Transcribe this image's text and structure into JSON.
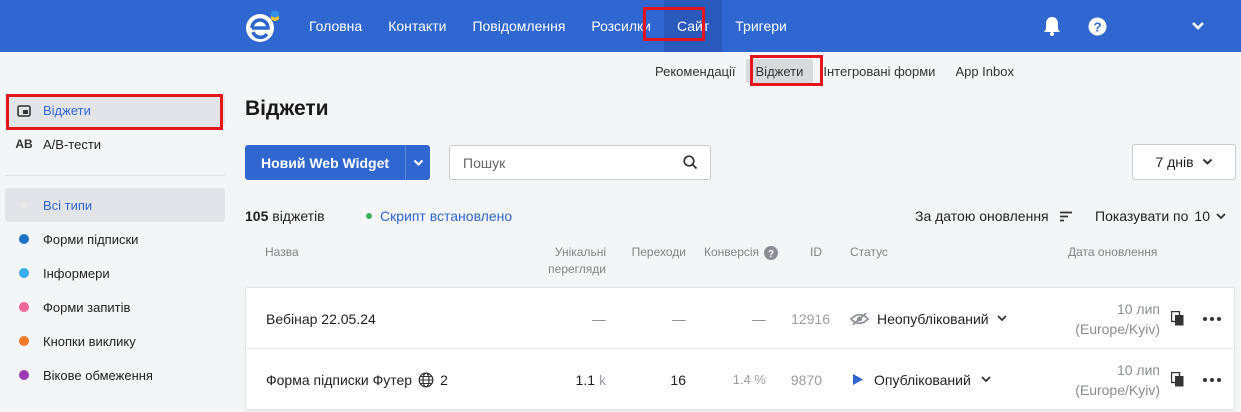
{
  "topnav": {
    "items": [
      {
        "label": "Головна"
      },
      {
        "label": "Контакти"
      },
      {
        "label": "Повідомлення"
      },
      {
        "label": "Розсилки"
      },
      {
        "label": "Сайт",
        "active": true
      },
      {
        "label": "Тригери"
      }
    ],
    "icons": [
      "bell-icon",
      "help-icon",
      "chevron-down-icon"
    ]
  },
  "subnav": {
    "items": [
      {
        "label": "Рекомендації"
      },
      {
        "label": "Віджети",
        "active": true
      },
      {
        "label": "Інтегровані форми"
      },
      {
        "label": "App Inbox"
      }
    ]
  },
  "sidebar": {
    "sections": [
      {
        "label": "Віджети",
        "icon": "widget-icon",
        "active": true
      },
      {
        "label": "A/B-тести",
        "icon_text": "AB"
      }
    ],
    "types": [
      {
        "label": "Всі типи",
        "color": "#e6e6e6",
        "active": true
      },
      {
        "label": "Форми підписки",
        "color": "#1a73c8"
      },
      {
        "label": "Інформери",
        "color": "#3aabee"
      },
      {
        "label": "Форми запитів",
        "color": "#ee6597"
      },
      {
        "label": "Кнопки виклику",
        "color": "#f07a2c"
      },
      {
        "label": "Вікове обмеження",
        "color": "#9b3bb8"
      }
    ]
  },
  "page": {
    "title": "Віджети",
    "new_button": "Новий Web Widget",
    "search_placeholder": "Пошук",
    "period": "7 днів",
    "count_number": "105",
    "count_label": "віджетів",
    "script_status": "Скрипт встановлено",
    "sort_label": "За датою оновлення",
    "show_label": "Показувати по",
    "show_value": "10"
  },
  "table": {
    "headers": {
      "name": "Назва",
      "views_line1": "Унікальні",
      "views_line2": "перегляди",
      "clicks": "Переходи",
      "conversion": "Конверсія",
      "id": "ID",
      "status": "Статус",
      "updated": "Дата оновлення"
    },
    "rows": [
      {
        "name": "Вебінар 22.05.24",
        "views": "—",
        "views_unit": "",
        "clicks": "—",
        "conversion": "—",
        "id": "12916",
        "status": "Неопублікований",
        "status_icon": "eye-off-icon",
        "date": "10 лип",
        "tz": "(Europe/Kyiv)",
        "globe": false,
        "globe_count": ""
      },
      {
        "name": "Форма підписки Футер",
        "views": "1.1",
        "views_unit": "k",
        "clicks": "16",
        "conversion": "1.4 %",
        "id": "9870",
        "status": "Опублікований",
        "status_icon": "play-icon",
        "date": "10 лип",
        "tz": "(Europe/Kyiv)",
        "globe": true,
        "globe_count": "2"
      }
    ]
  },
  "colors": {
    "brand": "#2f66d0",
    "highlight": "#e3151a",
    "script_dot": "#3cb35a"
  }
}
